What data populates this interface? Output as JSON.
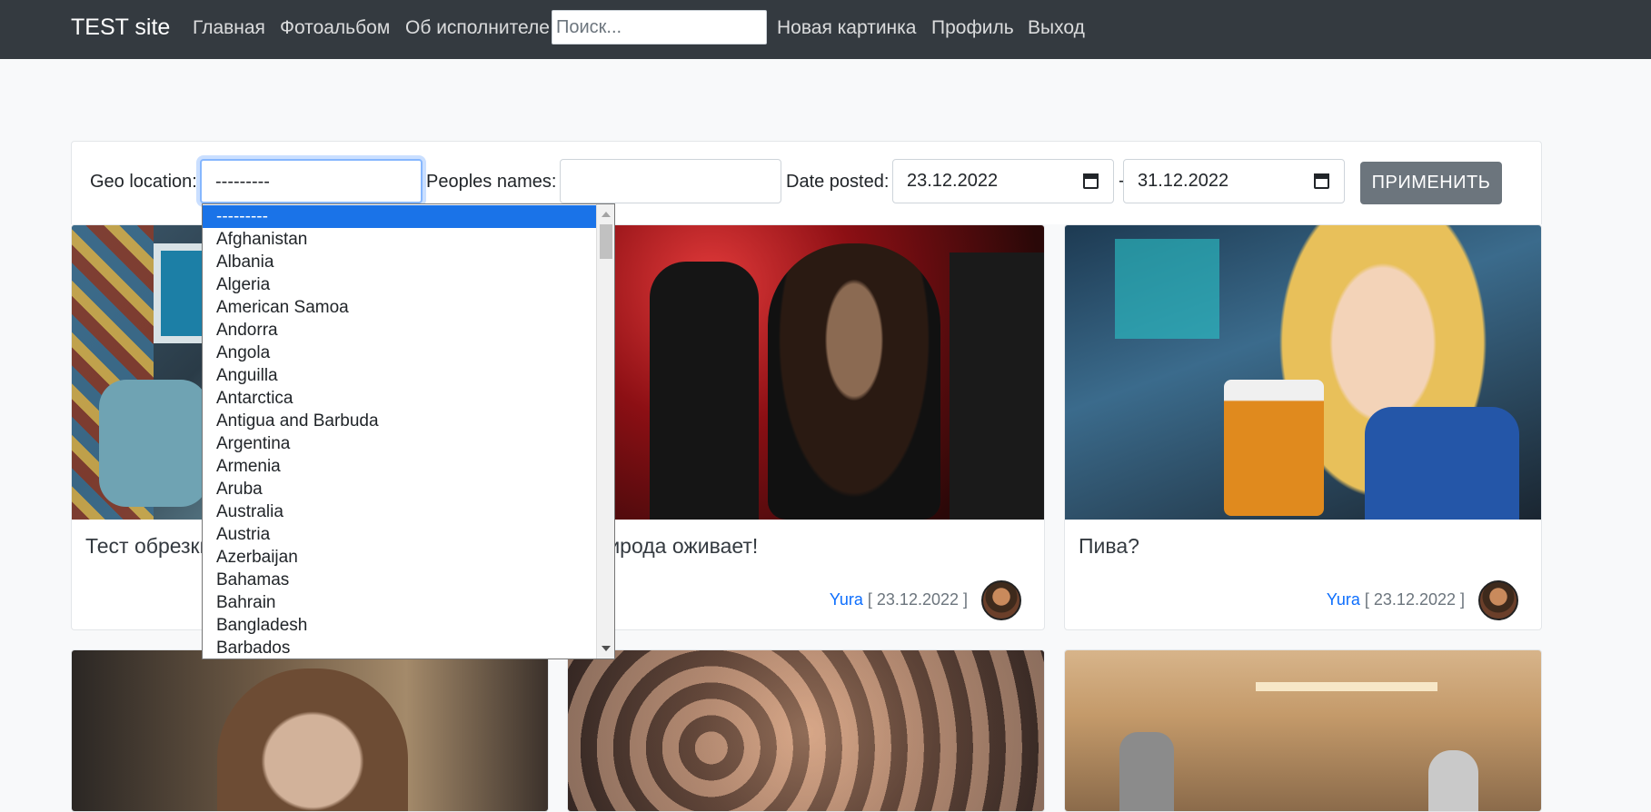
{
  "navbar": {
    "brand": "TEST site",
    "links": [
      "Главная",
      "Фотоальбом",
      "Об исполнителе"
    ],
    "search_placeholder": "Поиск...",
    "right_links": [
      "Новая картинка",
      "Профиль",
      "Выход"
    ]
  },
  "filters": {
    "geo_label": "Geo location:",
    "geo_value": "---------",
    "peoples_label": "Peoples names:",
    "peoples_value": "",
    "date_label": "Date posted:",
    "date_from": "23.12.2022",
    "date_separator": "-",
    "date_to": "31.12.2022",
    "apply_label": "Применить"
  },
  "dropdown": {
    "options": [
      "---------",
      "Afghanistan",
      "Albania",
      "Algeria",
      "American Samoa",
      "Andorra",
      "Angola",
      "Anguilla",
      "Antarctica",
      "Antigua and Barbuda",
      "Argentina",
      "Armenia",
      "Aruba",
      "Australia",
      "Austria",
      "Azerbaijan",
      "Bahamas",
      "Bahrain",
      "Bangladesh",
      "Barbados"
    ],
    "selected_index": 0
  },
  "cards": [
    {
      "title": "Тест обрезки",
      "author": "",
      "date": ""
    },
    {
      "title": "Природа оживает!",
      "author": "Yura",
      "date": "[ 23.12.2022 ]"
    },
    {
      "title": "Пива?",
      "author": "Yura",
      "date": "[ 23.12.2022 ]"
    }
  ],
  "colors": {
    "navbar": "#343a40",
    "page_bg": "#f8f9fa",
    "link_blue": "#0d6efd",
    "apply_button": "#6c757d",
    "selected_option": "#1a73e8"
  }
}
